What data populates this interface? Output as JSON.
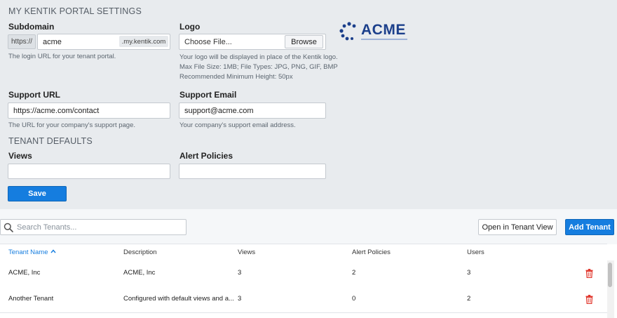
{
  "portal_settings": {
    "title": "MY KENTIK PORTAL SETTINGS",
    "subdomain": {
      "label": "Subdomain",
      "prefix": "https://",
      "value": "acme",
      "suffix": ".my.kentik.com",
      "help": "The login URL for your tenant portal."
    },
    "logo": {
      "label": "Logo",
      "file_placeholder": "Choose File...",
      "browse_label": "Browse",
      "help_lines": [
        "Your logo will be displayed in place of the Kentik logo.",
        "Max File Size: 1MB; File Types: JPG, PNG, GIF, BMP",
        "Recommended Minimum Height: 50px"
      ],
      "preview_text": "ACME"
    },
    "support_url": {
      "label": "Support URL",
      "value": "https://acme.com/contact",
      "help": "The URL for your company's support page."
    },
    "support_email": {
      "label": "Support Email",
      "value": "support@acme.com",
      "help": "Your company's support email address."
    }
  },
  "tenant_defaults": {
    "title": "TENANT DEFAULTS",
    "views": {
      "label": "Views",
      "value": ""
    },
    "alert_policies": {
      "label": "Alert Policies",
      "value": ""
    },
    "save_label": "Save"
  },
  "toolbar": {
    "search_placeholder": "Search Tenants...",
    "open_tenant_view_label": "Open in Tenant View",
    "add_tenant_label": "Add Tenant"
  },
  "table": {
    "columns": [
      "Tenant Name",
      "Description",
      "Views",
      "Alert Policies",
      "Users"
    ],
    "sort_indicator": "^",
    "rows": [
      {
        "name": "ACME, Inc",
        "description": "ACME, Inc",
        "views": "3",
        "alert_policies": "2",
        "users": "3"
      },
      {
        "name": "Another Tenant",
        "description": "Configured with default views and a...",
        "views": "3",
        "alert_policies": "0",
        "users": "2"
      }
    ]
  },
  "colors": {
    "primary": "#157ddf",
    "delete": "#e0352b",
    "settings_bg": "#e8ebee",
    "logo_blue": "#1b3f8b"
  },
  "icons": [
    "search-icon",
    "sort-asc-icon",
    "trash-icon",
    "acme-logo"
  ]
}
